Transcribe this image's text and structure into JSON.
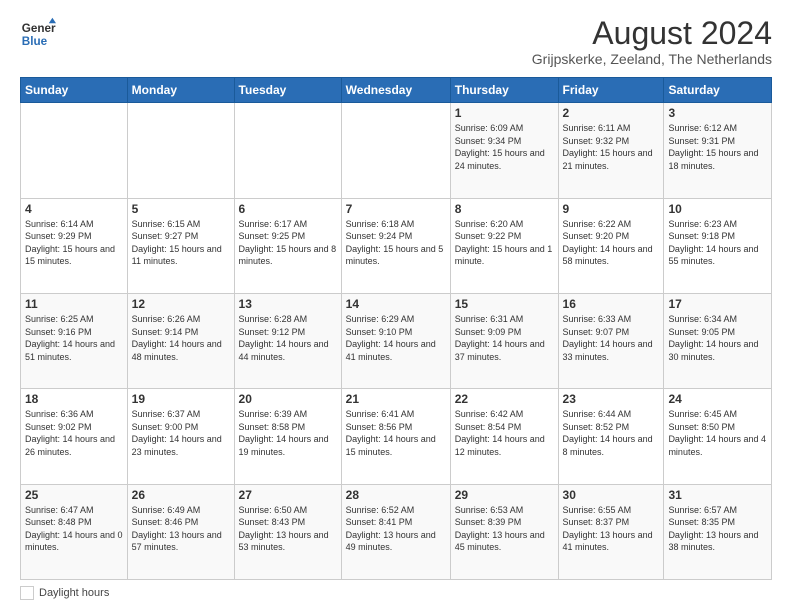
{
  "logo": {
    "general": "General",
    "blue": "Blue"
  },
  "title": "August 2024",
  "subtitle": "Grijpskerke, Zeeland, The Netherlands",
  "weekdays": [
    "Sunday",
    "Monday",
    "Tuesday",
    "Wednesday",
    "Thursday",
    "Friday",
    "Saturday"
  ],
  "weeks": [
    [
      {
        "day": "",
        "info": ""
      },
      {
        "day": "",
        "info": ""
      },
      {
        "day": "",
        "info": ""
      },
      {
        "day": "",
        "info": ""
      },
      {
        "day": "1",
        "info": "Sunrise: 6:09 AM\nSunset: 9:34 PM\nDaylight: 15 hours and 24 minutes."
      },
      {
        "day": "2",
        "info": "Sunrise: 6:11 AM\nSunset: 9:32 PM\nDaylight: 15 hours and 21 minutes."
      },
      {
        "day": "3",
        "info": "Sunrise: 6:12 AM\nSunset: 9:31 PM\nDaylight: 15 hours and 18 minutes."
      }
    ],
    [
      {
        "day": "4",
        "info": "Sunrise: 6:14 AM\nSunset: 9:29 PM\nDaylight: 15 hours and 15 minutes."
      },
      {
        "day": "5",
        "info": "Sunrise: 6:15 AM\nSunset: 9:27 PM\nDaylight: 15 hours and 11 minutes."
      },
      {
        "day": "6",
        "info": "Sunrise: 6:17 AM\nSunset: 9:25 PM\nDaylight: 15 hours and 8 minutes."
      },
      {
        "day": "7",
        "info": "Sunrise: 6:18 AM\nSunset: 9:24 PM\nDaylight: 15 hours and 5 minutes."
      },
      {
        "day": "8",
        "info": "Sunrise: 6:20 AM\nSunset: 9:22 PM\nDaylight: 15 hours and 1 minute."
      },
      {
        "day": "9",
        "info": "Sunrise: 6:22 AM\nSunset: 9:20 PM\nDaylight: 14 hours and 58 minutes."
      },
      {
        "day": "10",
        "info": "Sunrise: 6:23 AM\nSunset: 9:18 PM\nDaylight: 14 hours and 55 minutes."
      }
    ],
    [
      {
        "day": "11",
        "info": "Sunrise: 6:25 AM\nSunset: 9:16 PM\nDaylight: 14 hours and 51 minutes."
      },
      {
        "day": "12",
        "info": "Sunrise: 6:26 AM\nSunset: 9:14 PM\nDaylight: 14 hours and 48 minutes."
      },
      {
        "day": "13",
        "info": "Sunrise: 6:28 AM\nSunset: 9:12 PM\nDaylight: 14 hours and 44 minutes."
      },
      {
        "day": "14",
        "info": "Sunrise: 6:29 AM\nSunset: 9:10 PM\nDaylight: 14 hours and 41 minutes."
      },
      {
        "day": "15",
        "info": "Sunrise: 6:31 AM\nSunset: 9:09 PM\nDaylight: 14 hours and 37 minutes."
      },
      {
        "day": "16",
        "info": "Sunrise: 6:33 AM\nSunset: 9:07 PM\nDaylight: 14 hours and 33 minutes."
      },
      {
        "day": "17",
        "info": "Sunrise: 6:34 AM\nSunset: 9:05 PM\nDaylight: 14 hours and 30 minutes."
      }
    ],
    [
      {
        "day": "18",
        "info": "Sunrise: 6:36 AM\nSunset: 9:02 PM\nDaylight: 14 hours and 26 minutes."
      },
      {
        "day": "19",
        "info": "Sunrise: 6:37 AM\nSunset: 9:00 PM\nDaylight: 14 hours and 23 minutes."
      },
      {
        "day": "20",
        "info": "Sunrise: 6:39 AM\nSunset: 8:58 PM\nDaylight: 14 hours and 19 minutes."
      },
      {
        "day": "21",
        "info": "Sunrise: 6:41 AM\nSunset: 8:56 PM\nDaylight: 14 hours and 15 minutes."
      },
      {
        "day": "22",
        "info": "Sunrise: 6:42 AM\nSunset: 8:54 PM\nDaylight: 14 hours and 12 minutes."
      },
      {
        "day": "23",
        "info": "Sunrise: 6:44 AM\nSunset: 8:52 PM\nDaylight: 14 hours and 8 minutes."
      },
      {
        "day": "24",
        "info": "Sunrise: 6:45 AM\nSunset: 8:50 PM\nDaylight: 14 hours and 4 minutes."
      }
    ],
    [
      {
        "day": "25",
        "info": "Sunrise: 6:47 AM\nSunset: 8:48 PM\nDaylight: 14 hours and 0 minutes."
      },
      {
        "day": "26",
        "info": "Sunrise: 6:49 AM\nSunset: 8:46 PM\nDaylight: 13 hours and 57 minutes."
      },
      {
        "day": "27",
        "info": "Sunrise: 6:50 AM\nSunset: 8:43 PM\nDaylight: 13 hours and 53 minutes."
      },
      {
        "day": "28",
        "info": "Sunrise: 6:52 AM\nSunset: 8:41 PM\nDaylight: 13 hours and 49 minutes."
      },
      {
        "day": "29",
        "info": "Sunrise: 6:53 AM\nSunset: 8:39 PM\nDaylight: 13 hours and 45 minutes."
      },
      {
        "day": "30",
        "info": "Sunrise: 6:55 AM\nSunset: 8:37 PM\nDaylight: 13 hours and 41 minutes."
      },
      {
        "day": "31",
        "info": "Sunrise: 6:57 AM\nSunset: 8:35 PM\nDaylight: 13 hours and 38 minutes."
      }
    ]
  ],
  "footer": {
    "daylight_label": "Daylight hours"
  }
}
